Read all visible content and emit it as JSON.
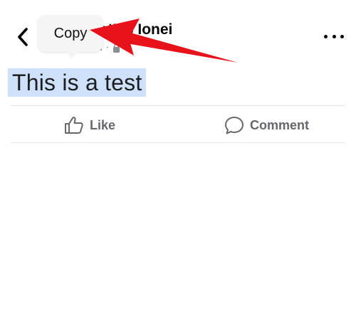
{
  "header": {
    "author_name": "estMc Ionei",
    "meta_text": "d ·",
    "lock_icon": "lock-icon",
    "back_icon": "chevron-left-icon",
    "more_icon": "more-dots-icon"
  },
  "post": {
    "text": "This is a test",
    "selection_color": "#cfe0fb"
  },
  "actions": {
    "like_label": "Like",
    "comment_label": "Comment"
  },
  "context_menu": {
    "copy_label": "Copy"
  },
  "annotation": {
    "arrow_color": "#e8131a"
  }
}
